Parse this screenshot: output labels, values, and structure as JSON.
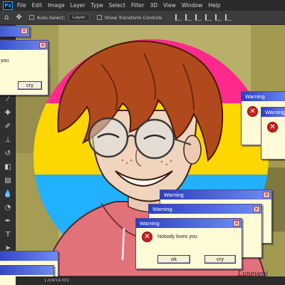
{
  "app": {
    "logo": "Ps",
    "menu": [
      "File",
      "Edit",
      "Image",
      "Layer",
      "Type",
      "Select",
      "Filter",
      "3D",
      "View",
      "Window",
      "Help"
    ]
  },
  "options_bar": {
    "auto_select_label": "Auto-Select:",
    "auto_select_value": "Layer",
    "transform_controls_label": "Show Transform Controls"
  },
  "toolbar_icons": [
    "move-icon",
    "marquee-icon",
    "lasso-icon",
    "quick-select-icon",
    "crop-icon",
    "eyedropper-icon",
    "healing-icon",
    "brush-icon",
    "stamp-icon",
    "history-brush-icon",
    "eraser-icon",
    "gradient-icon",
    "blur-icon",
    "dodge-icon",
    "pen-icon",
    "type-icon",
    "path-select-icon",
    "shape-icon",
    "hand-icon"
  ],
  "statusbar": {
    "text": "1,0/4/14,001"
  },
  "dialogs": {
    "top_left": {
      "message": "you",
      "cry_label": "cry"
    },
    "right_back": {
      "title": "Warning"
    },
    "right_front": {
      "title": "Warning"
    },
    "lower_back": {
      "title": "Warning"
    },
    "lower_mid": {
      "title": "Warning"
    },
    "lower_front": {
      "title": "Warning",
      "message": "Nobody loves you",
      "ok_label": "ok",
      "cry_label": "cry"
    }
  },
  "signature": "Luneveni",
  "colors": {
    "pan_pink": "#ff2a8c",
    "pan_yellow": "#ffd700",
    "pan_blue": "#21b1ff",
    "titlebar": "#4460e0",
    "dialog_bg": "#fffbd6",
    "error_red": "#c91f1f"
  }
}
